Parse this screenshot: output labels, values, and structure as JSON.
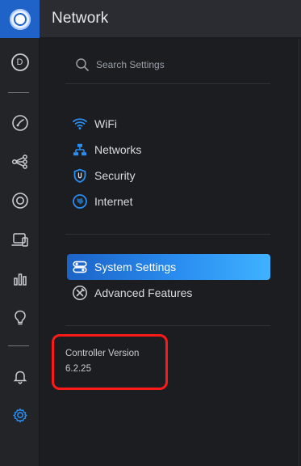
{
  "app": {
    "header_title": "Network",
    "colors": {
      "accent": "#2a8df0",
      "accent_dark": "#1c63c7",
      "sidebar_bg": "#222428",
      "header_bg": "#2a2c31",
      "panel_bg": "#1c1d20",
      "highlight": "#ff1a1a"
    }
  },
  "rail": {
    "user_initial": "D",
    "icons": [
      "dashboard-icon",
      "map-icon",
      "topology-icon",
      "devices-icon",
      "clients-icon",
      "stats-icon",
      "insights-icon",
      "alerts-icon",
      "settings-icon"
    ]
  },
  "search": {
    "placeholder": "Search Settings"
  },
  "menu": {
    "primary": [
      {
        "label": "WiFi",
        "icon": "wifi-icon"
      },
      {
        "label": "Networks",
        "icon": "networks-icon"
      },
      {
        "label": "Security",
        "icon": "shield-icon"
      },
      {
        "label": "Internet",
        "icon": "globe-icon"
      }
    ],
    "secondary": [
      {
        "label": "System Settings",
        "icon": "toggles-icon",
        "active": true
      },
      {
        "label": "Advanced Features",
        "icon": "tools-icon",
        "active": false
      }
    ]
  },
  "controller": {
    "label": "Controller Version",
    "version": "6.2.25"
  }
}
